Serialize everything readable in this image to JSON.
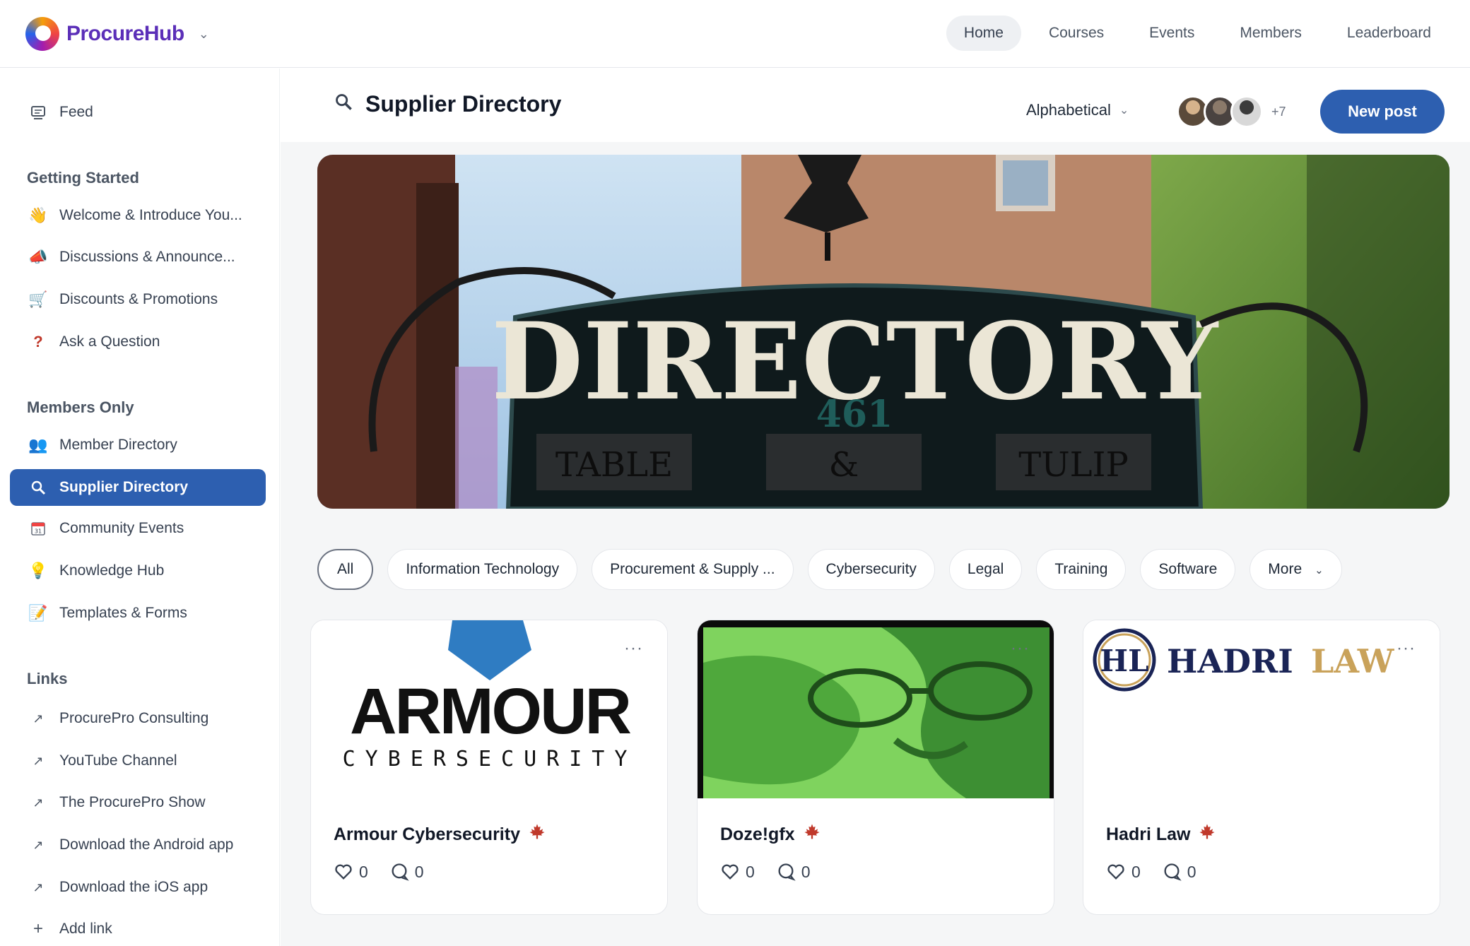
{
  "header": {
    "brand": {
      "name_part1": "Procure",
      "name_part2": "Hub"
    },
    "nav": [
      {
        "label": "Home",
        "active": true
      },
      {
        "label": "Courses",
        "active": false
      },
      {
        "label": "Events",
        "active": false
      },
      {
        "label": "Members",
        "active": false
      },
      {
        "label": "Leaderboard",
        "active": false
      }
    ]
  },
  "sidebar": {
    "feed": {
      "label": "Feed",
      "icon": "feed-icon"
    },
    "sections": [
      {
        "heading": "Getting Started",
        "items": [
          {
            "label": "Welcome & Introduce You...",
            "icon": "waving-hand-icon"
          },
          {
            "label": "Discussions & Announce...",
            "icon": "megaphone-icon"
          },
          {
            "label": "Discounts & Promotions",
            "icon": "shopping-cart-icon"
          },
          {
            "label": "Ask a Question",
            "icon": "question-mark-icon"
          }
        ]
      },
      {
        "heading": "Members Only",
        "items": [
          {
            "label": "Member Directory",
            "icon": "people-icon"
          },
          {
            "label": "Supplier Directory",
            "icon": "magnifier-icon",
            "active": true
          },
          {
            "label": "Community Events",
            "icon": "calendar-icon"
          },
          {
            "label": "Knowledge Hub",
            "icon": "lightbulb-icon"
          },
          {
            "label": "Templates & Forms",
            "icon": "memo-icon"
          }
        ]
      },
      {
        "heading": "Links",
        "items": [
          {
            "label": "ProcurePro Consulting",
            "icon": "external-link-icon"
          },
          {
            "label": "YouTube Channel",
            "icon": "external-link-icon"
          },
          {
            "label": "The ProcurePro Show",
            "icon": "external-link-icon"
          },
          {
            "label": "Download the Android app",
            "icon": "external-link-icon"
          },
          {
            "label": "Download the iOS app",
            "icon": "external-link-icon"
          },
          {
            "label": "Add link",
            "icon": "plus-icon"
          }
        ]
      }
    ]
  },
  "main": {
    "title": "Supplier Directory",
    "sort_label": "Alphabetical",
    "avatars_more": "+7",
    "new_post_label": "New post",
    "banner": {
      "sign_text": "DIRECTORY",
      "number": "461",
      "plaques": [
        "TABLE",
        "&",
        "TULIP"
      ]
    },
    "filters": [
      {
        "label": "All",
        "active": true
      },
      {
        "label": "Information Technology"
      },
      {
        "label": "Procurement & Supply ..."
      },
      {
        "label": "Cybersecurity"
      },
      {
        "label": "Legal"
      },
      {
        "label": "Training"
      },
      {
        "label": "Software"
      },
      {
        "label": "More"
      }
    ],
    "cards": [
      {
        "title": "Armour Cybersecurity",
        "likes": "0",
        "comments": "0",
        "logo": {
          "word": "ARMOUR",
          "sub": "CYBERSECURITY"
        }
      },
      {
        "title": "Doze!gfx",
        "likes": "0",
        "comments": "0"
      },
      {
        "title": "Hadri Law",
        "likes": "0",
        "comments": "0",
        "logo": {
          "monogram": "HL",
          "word1": "HADRI",
          "word2": "LAW"
        }
      }
    ],
    "colors": {
      "accent": "#2d5fb0",
      "leaf": "#c0392b"
    }
  }
}
